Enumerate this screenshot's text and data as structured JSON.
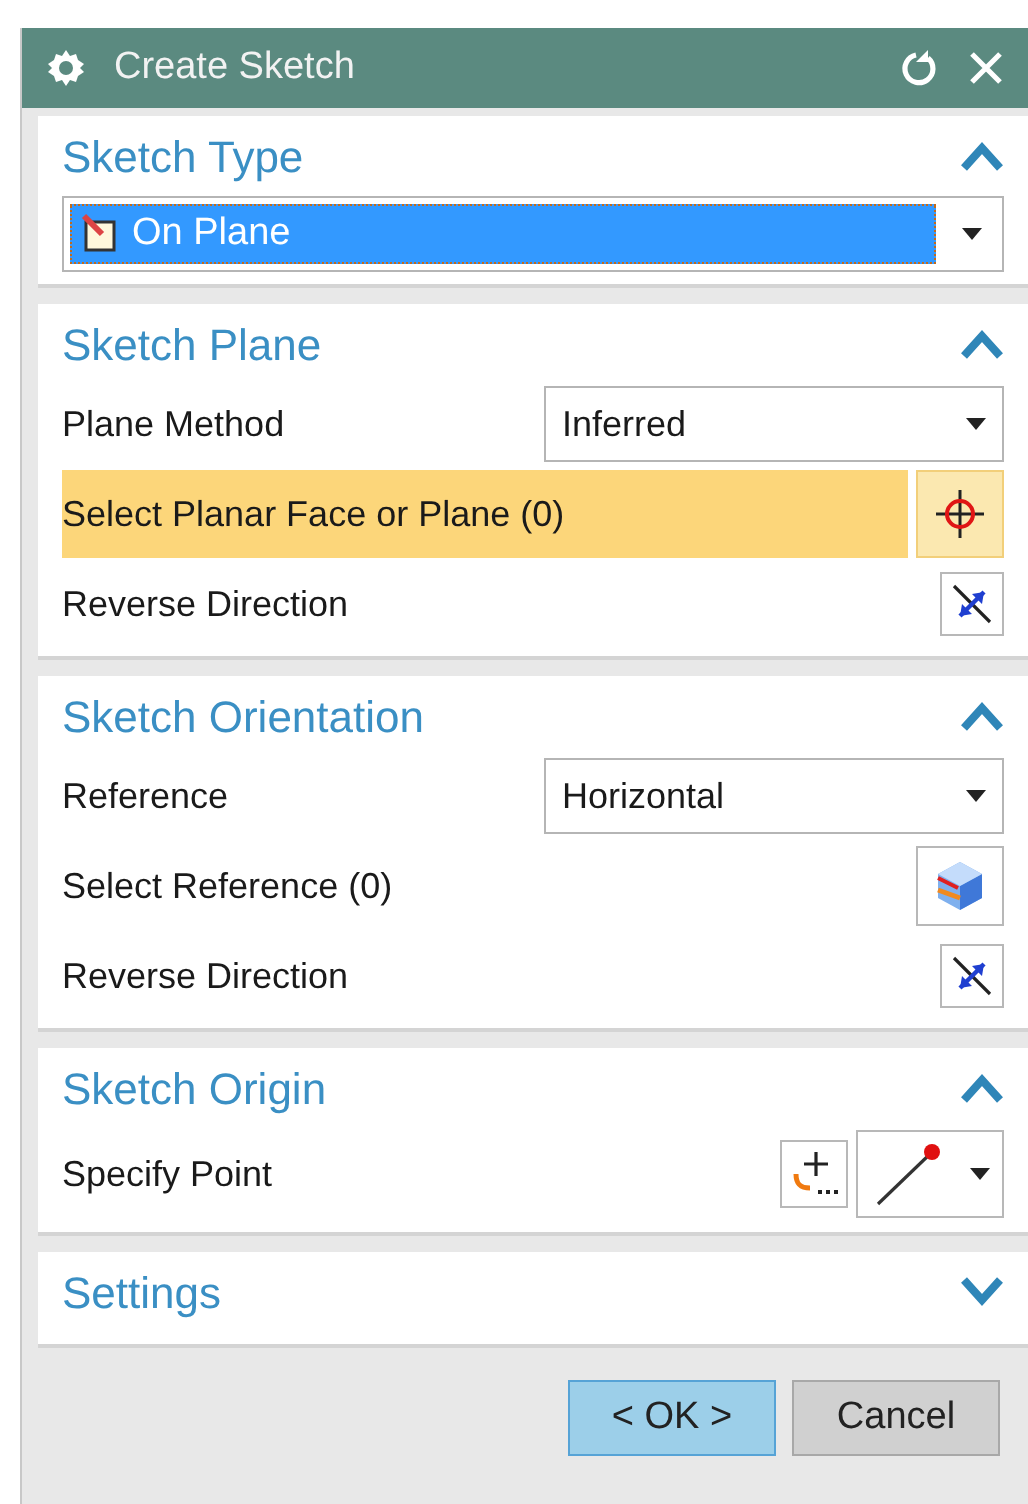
{
  "window": {
    "title": "Create Sketch"
  },
  "sections": [
    {
      "title": "Sketch Type",
      "expanded": true,
      "rows": [
        {
          "kind": "type_select",
          "value": "On Plane"
        }
      ]
    },
    {
      "title": "Sketch Plane",
      "expanded": true,
      "rows": [
        {
          "kind": "dropdown",
          "label": "Plane Method",
          "value": "Inferred"
        },
        {
          "kind": "face_selection",
          "label": "Select Planar Face or Plane (0)",
          "selected": true
        },
        {
          "kind": "toggle",
          "label": "Reverse Direction"
        }
      ]
    },
    {
      "title": "Sketch Orientation",
      "expanded": true,
      "rows": [
        {
          "kind": "dropdown",
          "label": "Reference",
          "value": "Horizontal"
        },
        {
          "kind": "reference_selection",
          "label": "Select Reference (0)",
          "selected": false
        },
        {
          "kind": "toggle",
          "label": "Reverse Direction"
        }
      ]
    },
    {
      "title": "Sketch Origin",
      "expanded": true,
      "rows": [
        {
          "kind": "point",
          "label": "Specify Point"
        }
      ]
    },
    {
      "title": "Settings",
      "expanded": false
    }
  ],
  "buttons": [
    {
      "label": "< OK >",
      "kind": "default"
    },
    {
      "label": "Cancel",
      "kind": "normal"
    }
  ]
}
